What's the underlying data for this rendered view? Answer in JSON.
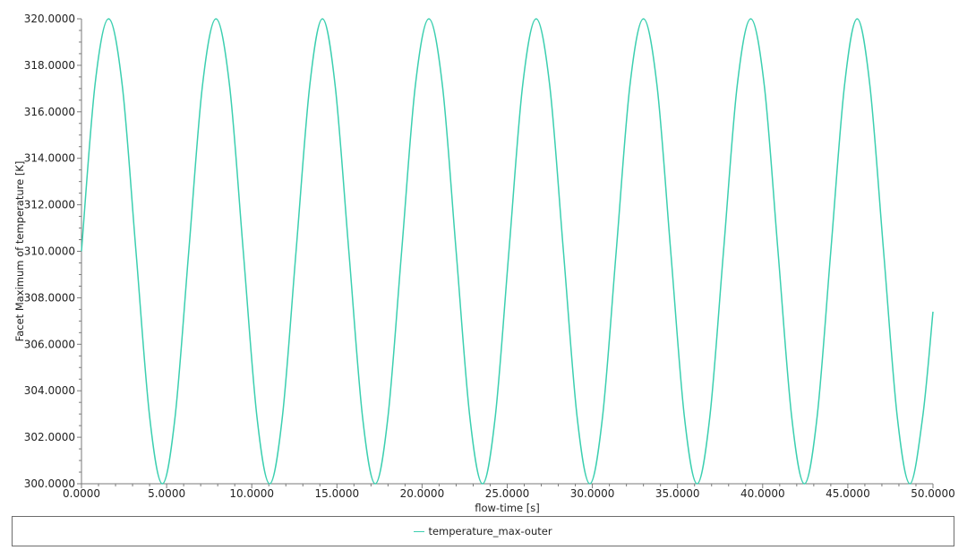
{
  "chart_data": {
    "type": "line",
    "title": "",
    "xlabel": "flow-time [s]",
    "ylabel": "Facet Maximum of temperature [K]",
    "xlim": [
      0,
      50
    ],
    "ylim": [
      300,
      320
    ],
    "x_ticks": [
      "0.0000",
      "5.0000",
      "10.0000",
      "15.0000",
      "20.0000",
      "25.0000",
      "30.0000",
      "35.0000",
      "40.0000",
      "45.0000",
      "50.0000"
    ],
    "y_ticks": [
      "300.0000",
      "302.0000",
      "304.0000",
      "306.0000",
      "308.0000",
      "310.0000",
      "312.0000",
      "314.0000",
      "316.0000",
      "318.0000",
      "320.0000"
    ],
    "grid": false,
    "legend_position": "bottom",
    "series": [
      {
        "name": "temperature_max-outer",
        "color": "#3ccfb0",
        "x": [
          0.0,
          0.8,
          1.6,
          2.4,
          3.2,
          4.0,
          4.75,
          5.5,
          6.3,
          7.1,
          7.9,
          8.7,
          9.5,
          10.3,
          11.05,
          11.8,
          12.6,
          13.4,
          14.15,
          14.9,
          15.7,
          16.5,
          17.25,
          18.0,
          18.8,
          19.6,
          20.4,
          21.2,
          22.0,
          22.8,
          23.55,
          24.3,
          25.1,
          25.9,
          26.7,
          27.5,
          28.3,
          29.1,
          29.85,
          30.6,
          31.4,
          32.2,
          33.0,
          33.8,
          34.6,
          35.4,
          36.15,
          36.9,
          37.7,
          38.5,
          39.3,
          40.1,
          40.9,
          41.7,
          42.45,
          43.2,
          44.0,
          44.8,
          45.55,
          46.3,
          47.1,
          47.9,
          48.65,
          49.4,
          50.0
        ],
        "y": [
          310.0,
          317.2,
          320.0,
          317.1,
          310.0,
          302.9,
          300.0,
          302.9,
          310.0,
          317.1,
          320.0,
          317.1,
          310.0,
          302.9,
          300.0,
          302.9,
          310.0,
          317.1,
          320.0,
          317.1,
          310.0,
          302.9,
          300.0,
          302.9,
          310.0,
          317.1,
          320.0,
          317.1,
          310.0,
          302.9,
          300.0,
          302.9,
          310.0,
          317.1,
          320.0,
          317.1,
          310.0,
          302.9,
          300.0,
          302.9,
          310.0,
          317.1,
          320.0,
          317.1,
          310.0,
          302.9,
          300.0,
          302.9,
          310.0,
          317.1,
          320.0,
          317.1,
          310.0,
          302.9,
          300.0,
          302.9,
          310.0,
          317.1,
          320.0,
          317.1,
          310.0,
          302.9,
          300.0,
          302.9,
          307.4
        ]
      }
    ]
  }
}
